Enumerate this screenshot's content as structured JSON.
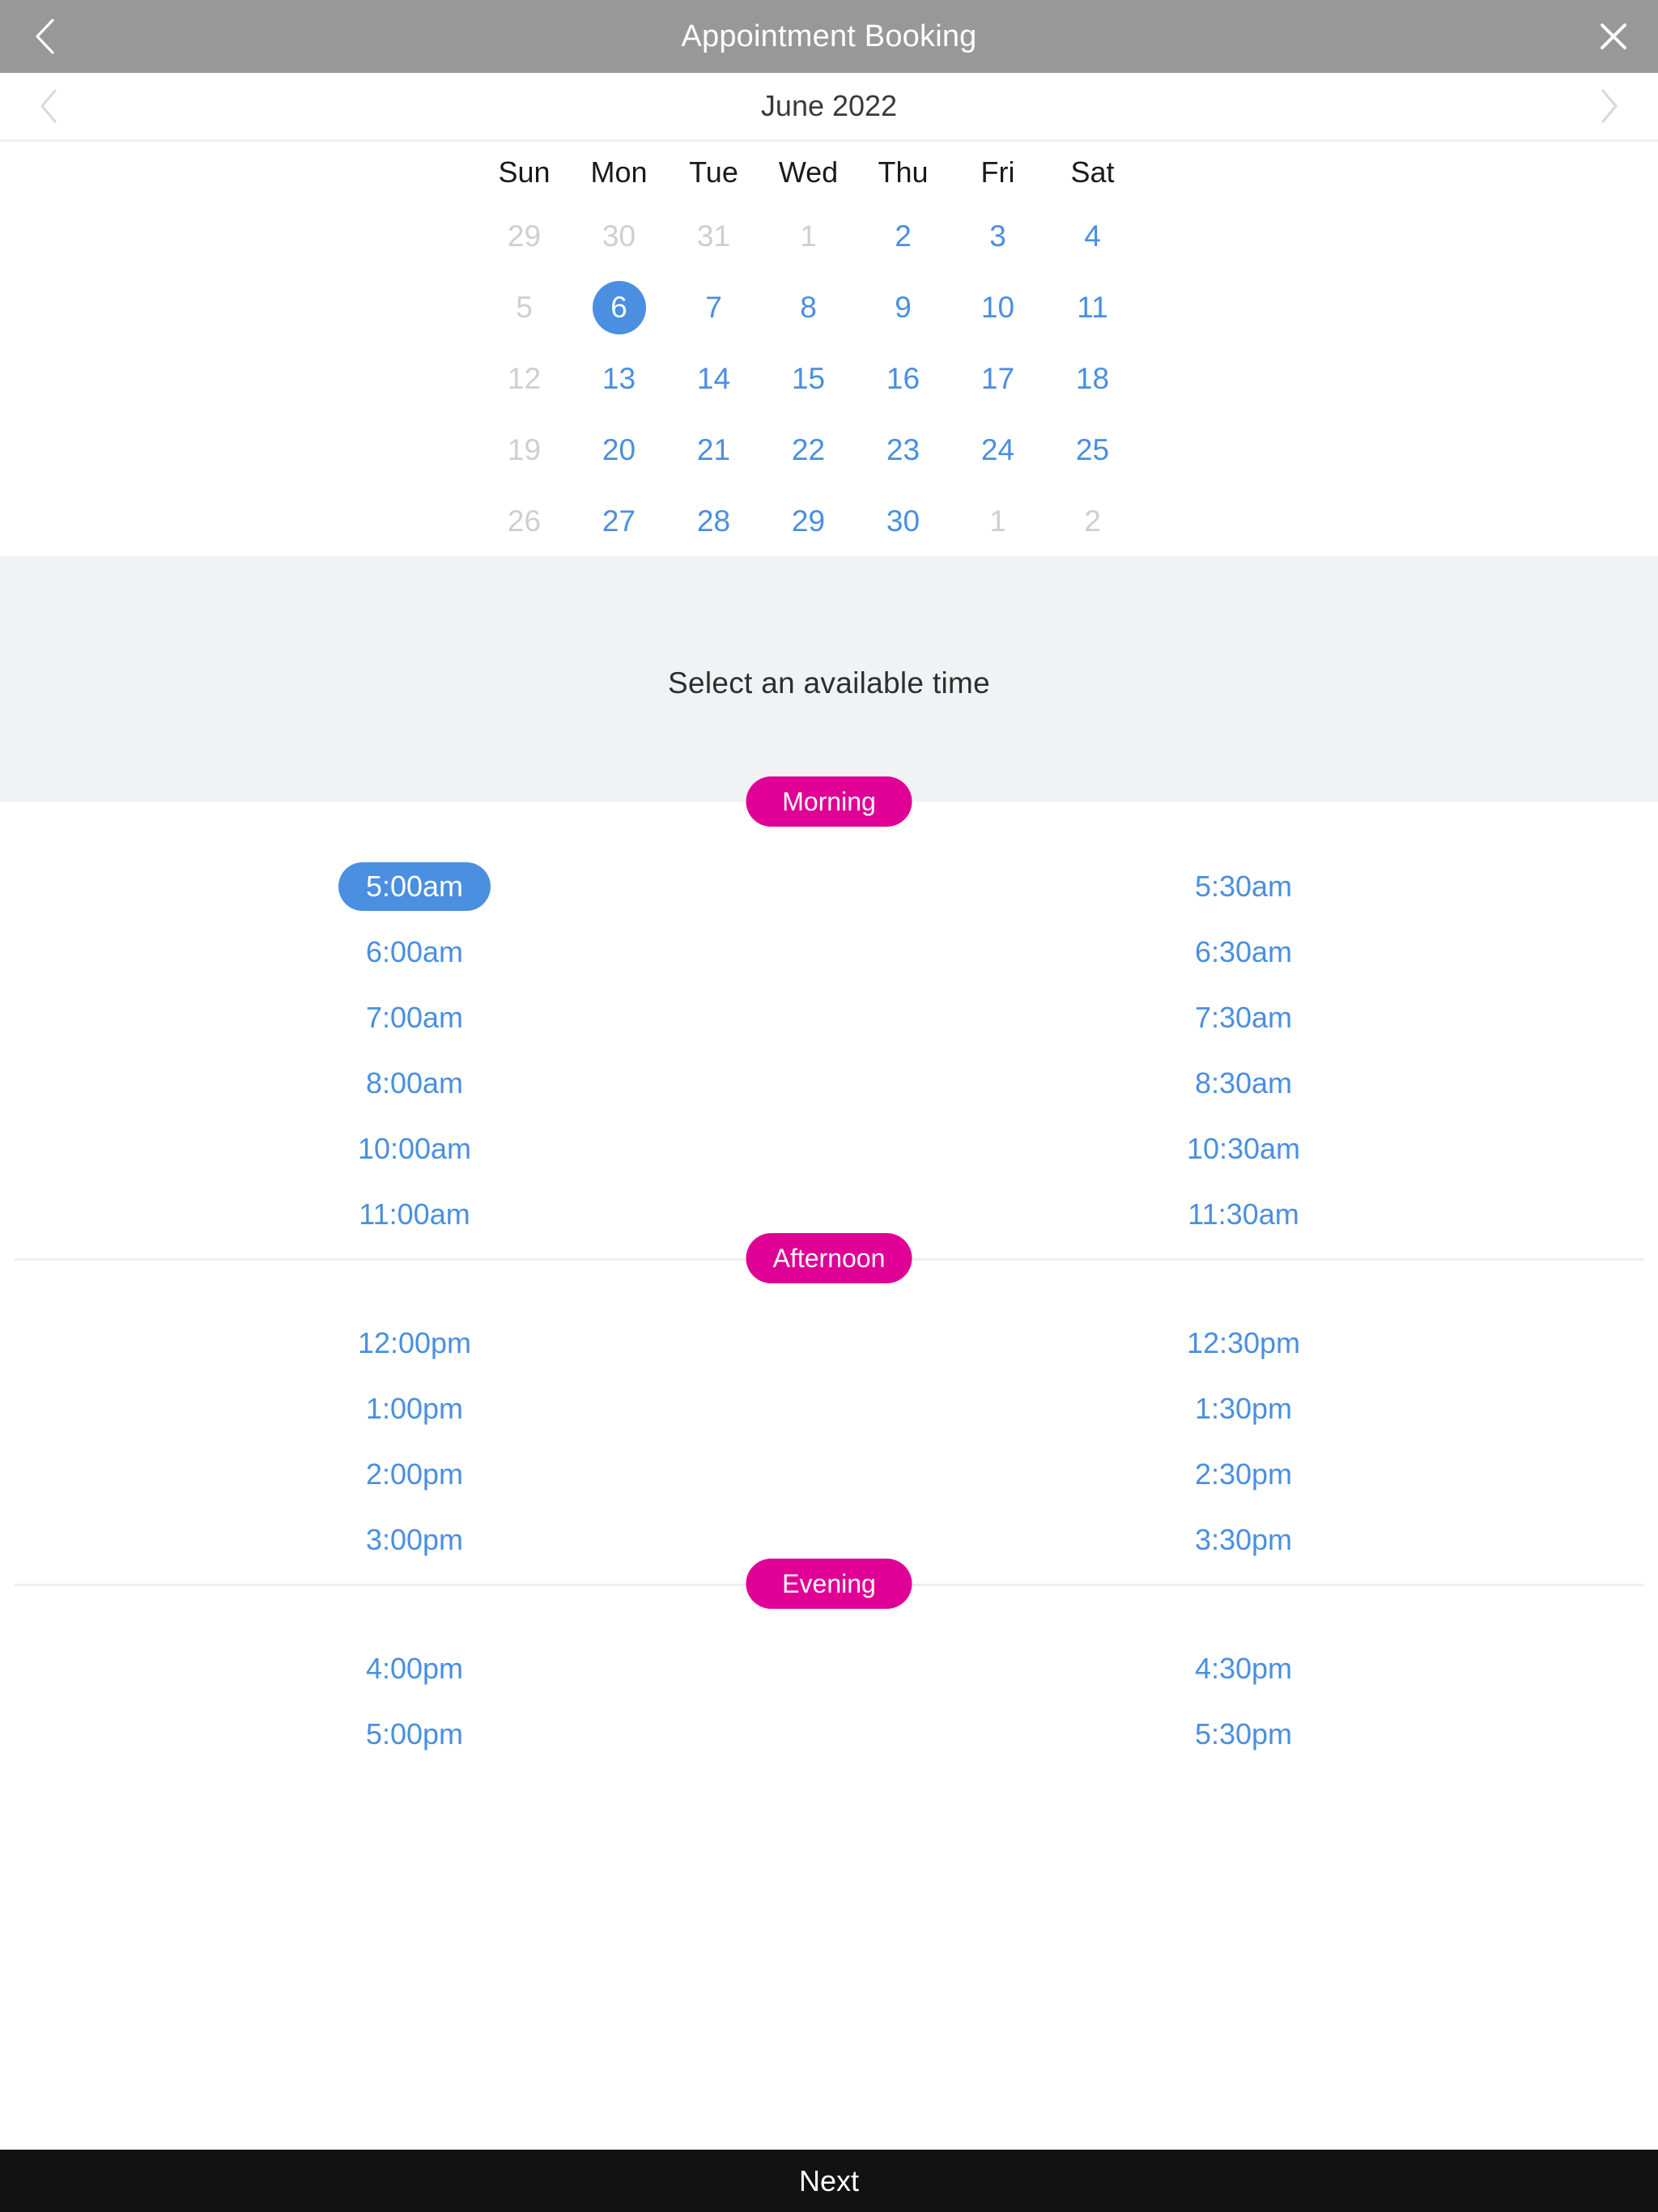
{
  "header": {
    "title": "Appointment Booking",
    "back_icon": "chevron-left-icon",
    "close_icon": "close-icon"
  },
  "month_nav": {
    "label": "June 2022",
    "prev_icon": "chevron-left-icon",
    "next_icon": "chevron-right-icon"
  },
  "calendar": {
    "weekdays": [
      "Sun",
      "Mon",
      "Tue",
      "Wed",
      "Thu",
      "Fri",
      "Sat"
    ],
    "selected_day": "6",
    "weeks": [
      [
        {
          "n": "29",
          "state": "muted"
        },
        {
          "n": "30",
          "state": "muted"
        },
        {
          "n": "31",
          "state": "muted"
        },
        {
          "n": "1",
          "state": "muted"
        },
        {
          "n": "2",
          "state": "active"
        },
        {
          "n": "3",
          "state": "active"
        },
        {
          "n": "4",
          "state": "active"
        }
      ],
      [
        {
          "n": "5",
          "state": "muted"
        },
        {
          "n": "6",
          "state": "selected"
        },
        {
          "n": "7",
          "state": "active"
        },
        {
          "n": "8",
          "state": "active"
        },
        {
          "n": "9",
          "state": "active"
        },
        {
          "n": "10",
          "state": "active"
        },
        {
          "n": "11",
          "state": "active"
        }
      ],
      [
        {
          "n": "12",
          "state": "muted"
        },
        {
          "n": "13",
          "state": "active"
        },
        {
          "n": "14",
          "state": "active"
        },
        {
          "n": "15",
          "state": "active"
        },
        {
          "n": "16",
          "state": "active"
        },
        {
          "n": "17",
          "state": "active"
        },
        {
          "n": "18",
          "state": "active"
        }
      ],
      [
        {
          "n": "19",
          "state": "muted"
        },
        {
          "n": "20",
          "state": "active"
        },
        {
          "n": "21",
          "state": "active"
        },
        {
          "n": "22",
          "state": "active"
        },
        {
          "n": "23",
          "state": "active"
        },
        {
          "n": "24",
          "state": "active"
        },
        {
          "n": "25",
          "state": "active"
        }
      ],
      [
        {
          "n": "26",
          "state": "muted"
        },
        {
          "n": "27",
          "state": "active"
        },
        {
          "n": "28",
          "state": "active"
        },
        {
          "n": "29",
          "state": "active"
        },
        {
          "n": "30",
          "state": "active"
        },
        {
          "n": "1",
          "state": "muted"
        },
        {
          "n": "2",
          "state": "muted"
        }
      ]
    ]
  },
  "time_picker": {
    "prompt": "Select an available time",
    "selected_time": "5:00am",
    "sections": [
      {
        "label": "Morning",
        "rows": [
          [
            "5:00am",
            "5:30am"
          ],
          [
            "6:00am",
            "6:30am"
          ],
          [
            "7:00am",
            "7:30am"
          ],
          [
            "8:00am",
            "8:30am"
          ],
          [
            "10:00am",
            "10:30am"
          ],
          [
            "11:00am",
            "11:30am"
          ]
        ]
      },
      {
        "label": "Afternoon",
        "rows": [
          [
            "12:00pm",
            "12:30pm"
          ],
          [
            "1:00pm",
            "1:30pm"
          ],
          [
            "2:00pm",
            "2:30pm"
          ],
          [
            "3:00pm",
            "3:30pm"
          ]
        ]
      },
      {
        "label": "Evening",
        "rows": [
          [
            "4:00pm",
            "4:30pm"
          ],
          [
            "5:00pm",
            "5:30pm"
          ]
        ]
      }
    ]
  },
  "footer": {
    "next_label": "Next"
  },
  "colors": {
    "header_bg": "#989898",
    "accent_blue": "#4a8fe0",
    "accent_pink": "#e00095",
    "band_gray": "#f1f2f3",
    "footer_bg": "#121212"
  }
}
